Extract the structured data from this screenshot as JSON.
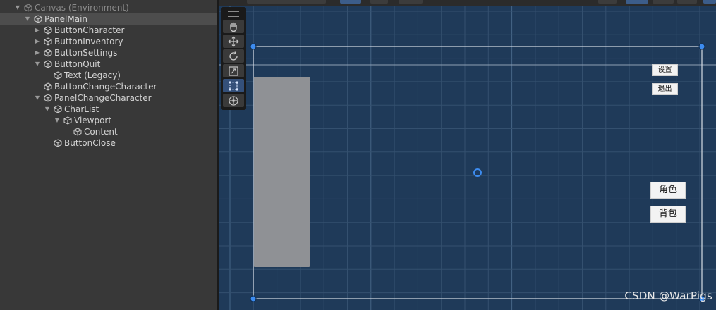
{
  "hierarchy": {
    "items": [
      {
        "label": "Canvas (Environment)",
        "depth": 0,
        "expander": "open",
        "state": "dim"
      },
      {
        "label": "PanelMain",
        "depth": 1,
        "expander": "open",
        "state": "selected"
      },
      {
        "label": "ButtonCharacter",
        "depth": 2,
        "expander": "closed",
        "state": "normal"
      },
      {
        "label": "ButtonInventory",
        "depth": 2,
        "expander": "closed",
        "state": "normal"
      },
      {
        "label": "ButtonSettings",
        "depth": 2,
        "expander": "closed",
        "state": "normal"
      },
      {
        "label": "ButtonQuit",
        "depth": 2,
        "expander": "open",
        "state": "normal"
      },
      {
        "label": "Text (Legacy)",
        "depth": 3,
        "expander": "none",
        "state": "normal"
      },
      {
        "label": "ButtonChangeCharacter",
        "depth": 2,
        "expander": "none",
        "state": "normal"
      },
      {
        "label": "PanelChangeCharacter",
        "depth": 2,
        "expander": "open",
        "state": "normal"
      },
      {
        "label": "CharList",
        "depth": 3,
        "expander": "open",
        "state": "normal"
      },
      {
        "label": "Viewport",
        "depth": 4,
        "expander": "open",
        "state": "normal"
      },
      {
        "label": "Content",
        "depth": 5,
        "expander": "none",
        "state": "normal"
      },
      {
        "label": "ButtonClose",
        "depth": 3,
        "expander": "none",
        "state": "normal"
      }
    ]
  },
  "scene": {
    "toolbar": {
      "tools": [
        {
          "name": "hand-tool",
          "icon": "hand-icon",
          "active": false
        },
        {
          "name": "move-tool",
          "icon": "move-arrows-icon",
          "active": false
        },
        {
          "name": "rotate-tool",
          "icon": "rotate-icon",
          "active": false
        },
        {
          "name": "scale-tool",
          "icon": "scale-icon",
          "active": false
        },
        {
          "name": "rect-tool",
          "icon": "rect-transform-icon",
          "active": true
        },
        {
          "name": "transform-tool",
          "icon": "transform-icon",
          "active": false
        }
      ]
    },
    "buttons": {
      "settings": "设置",
      "quit": "退出",
      "character": "角色",
      "inventory": "背包"
    },
    "watermark": "CSDN @WarPigs",
    "colors": {
      "scene_bg": "#1f3a59",
      "grid_line": "#3f5c7c",
      "handle": "#3d8cf0",
      "selection_outline": "#d7dde5",
      "hierarchy_bg": "#383838"
    }
  }
}
